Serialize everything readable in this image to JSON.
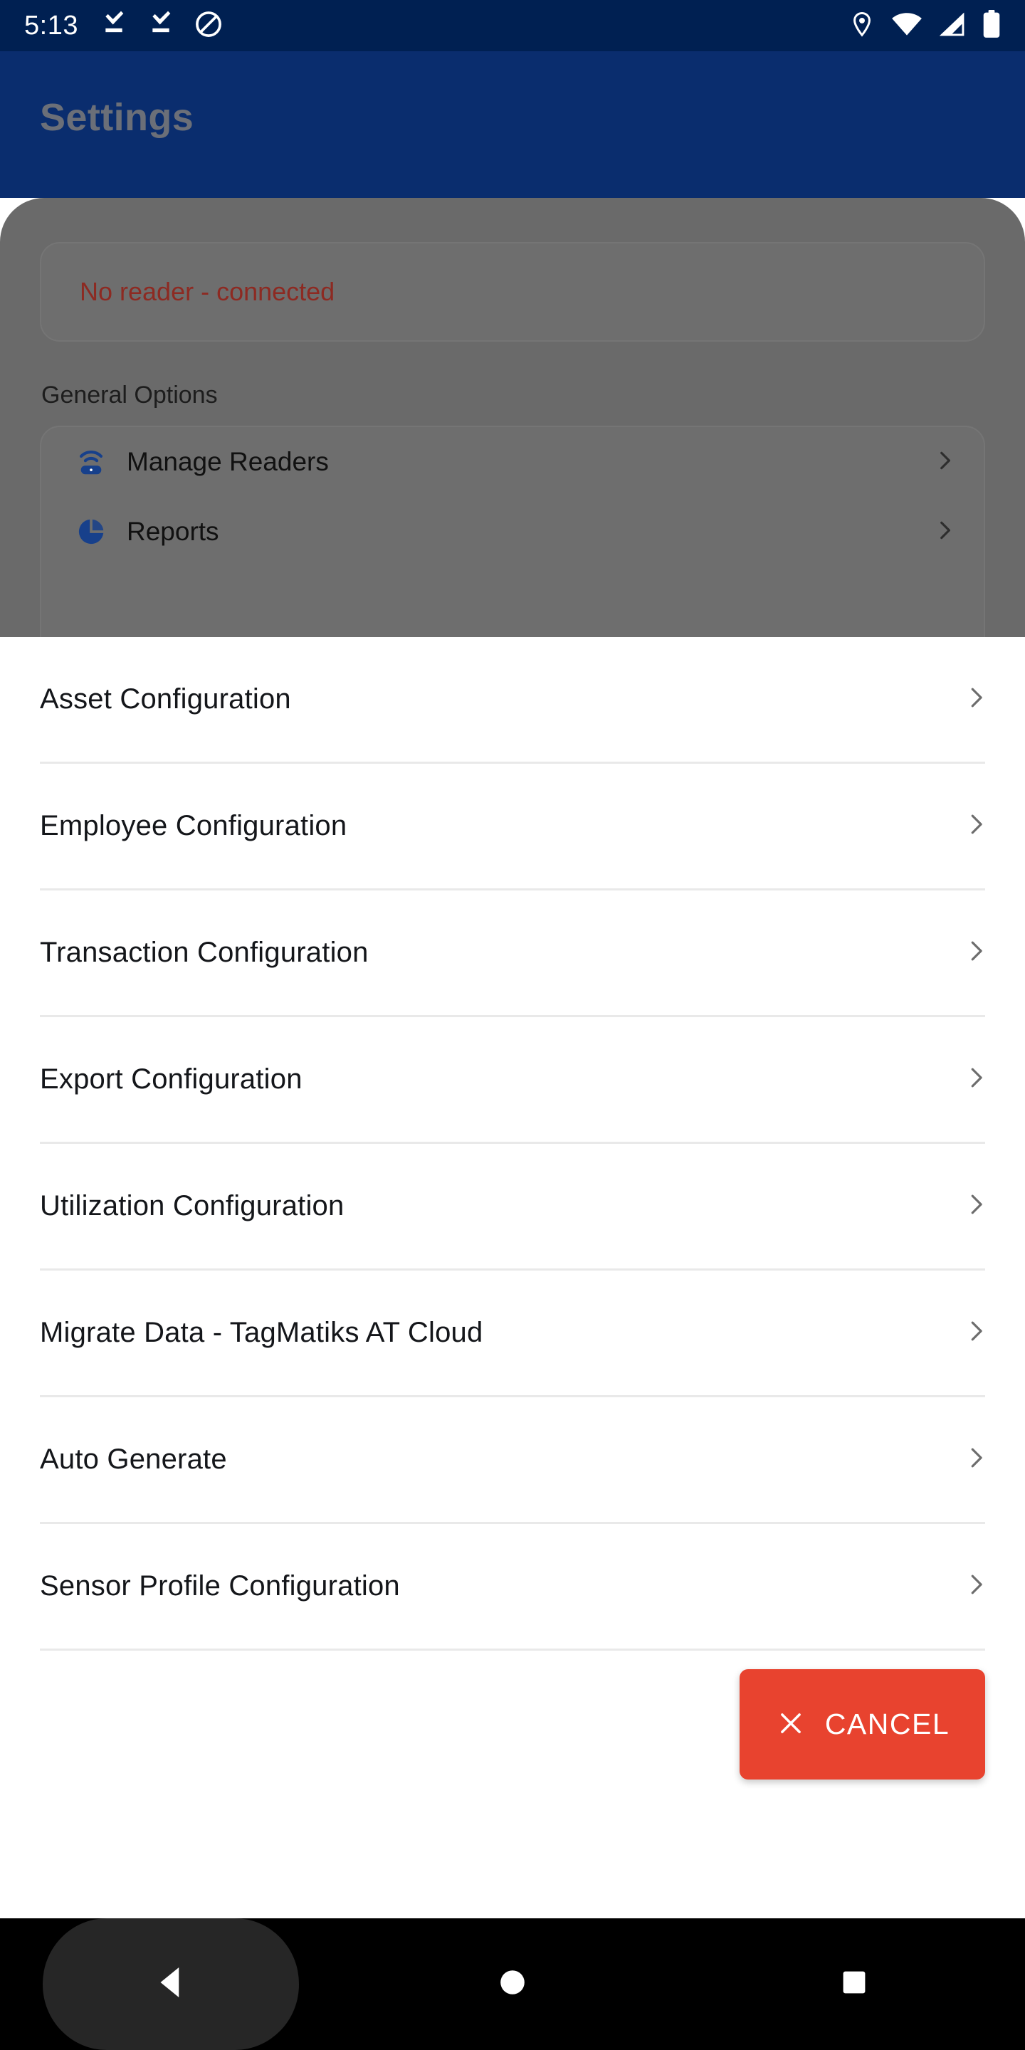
{
  "statusbar": {
    "time": "5:13",
    "left_icons": [
      "download-icon",
      "download-icon",
      "do-not-disturb-icon"
    ],
    "right_icons": [
      "location-icon",
      "wifi-icon",
      "cellular-signal-icon",
      "battery-icon"
    ]
  },
  "header": {
    "title": "Settings",
    "background_color": "#0a2d6e"
  },
  "background_screen": {
    "reader_status": "No reader - connected",
    "reader_status_color": "#8d2a22",
    "section_label": "General Options",
    "options": [
      {
        "label": "Manage Readers",
        "icon": "reader-router-icon",
        "chevron": "chevron-right-icon"
      },
      {
        "label": "Reports",
        "icon": "pie-chart-icon",
        "chevron": "chevron-right-icon"
      }
    ]
  },
  "sheet": {
    "items": [
      {
        "label": "Asset Configuration",
        "chevron": "chevron-right-icon"
      },
      {
        "label": "Employee Configuration",
        "chevron": "chevron-right-icon"
      },
      {
        "label": "Transaction Configuration",
        "chevron": "chevron-right-icon"
      },
      {
        "label": "Export Configuration",
        "chevron": "chevron-right-icon"
      },
      {
        "label": "Utilization Configuration",
        "chevron": "chevron-right-icon"
      },
      {
        "label": "Migrate Data - TagMatiks AT Cloud",
        "chevron": "chevron-right-icon"
      },
      {
        "label": "Auto Generate",
        "chevron": "chevron-right-icon"
      },
      {
        "label": "Sensor Profile Configuration",
        "chevron": "chevron-right-icon"
      }
    ],
    "cancel_button": {
      "label": "CANCEL",
      "icon": "close-x-icon",
      "color": "#e8432f"
    }
  },
  "navbar": {
    "back_label": "back-triangle-icon",
    "home_label": "home-circle-icon",
    "recents_label": "recents-square-icon"
  }
}
